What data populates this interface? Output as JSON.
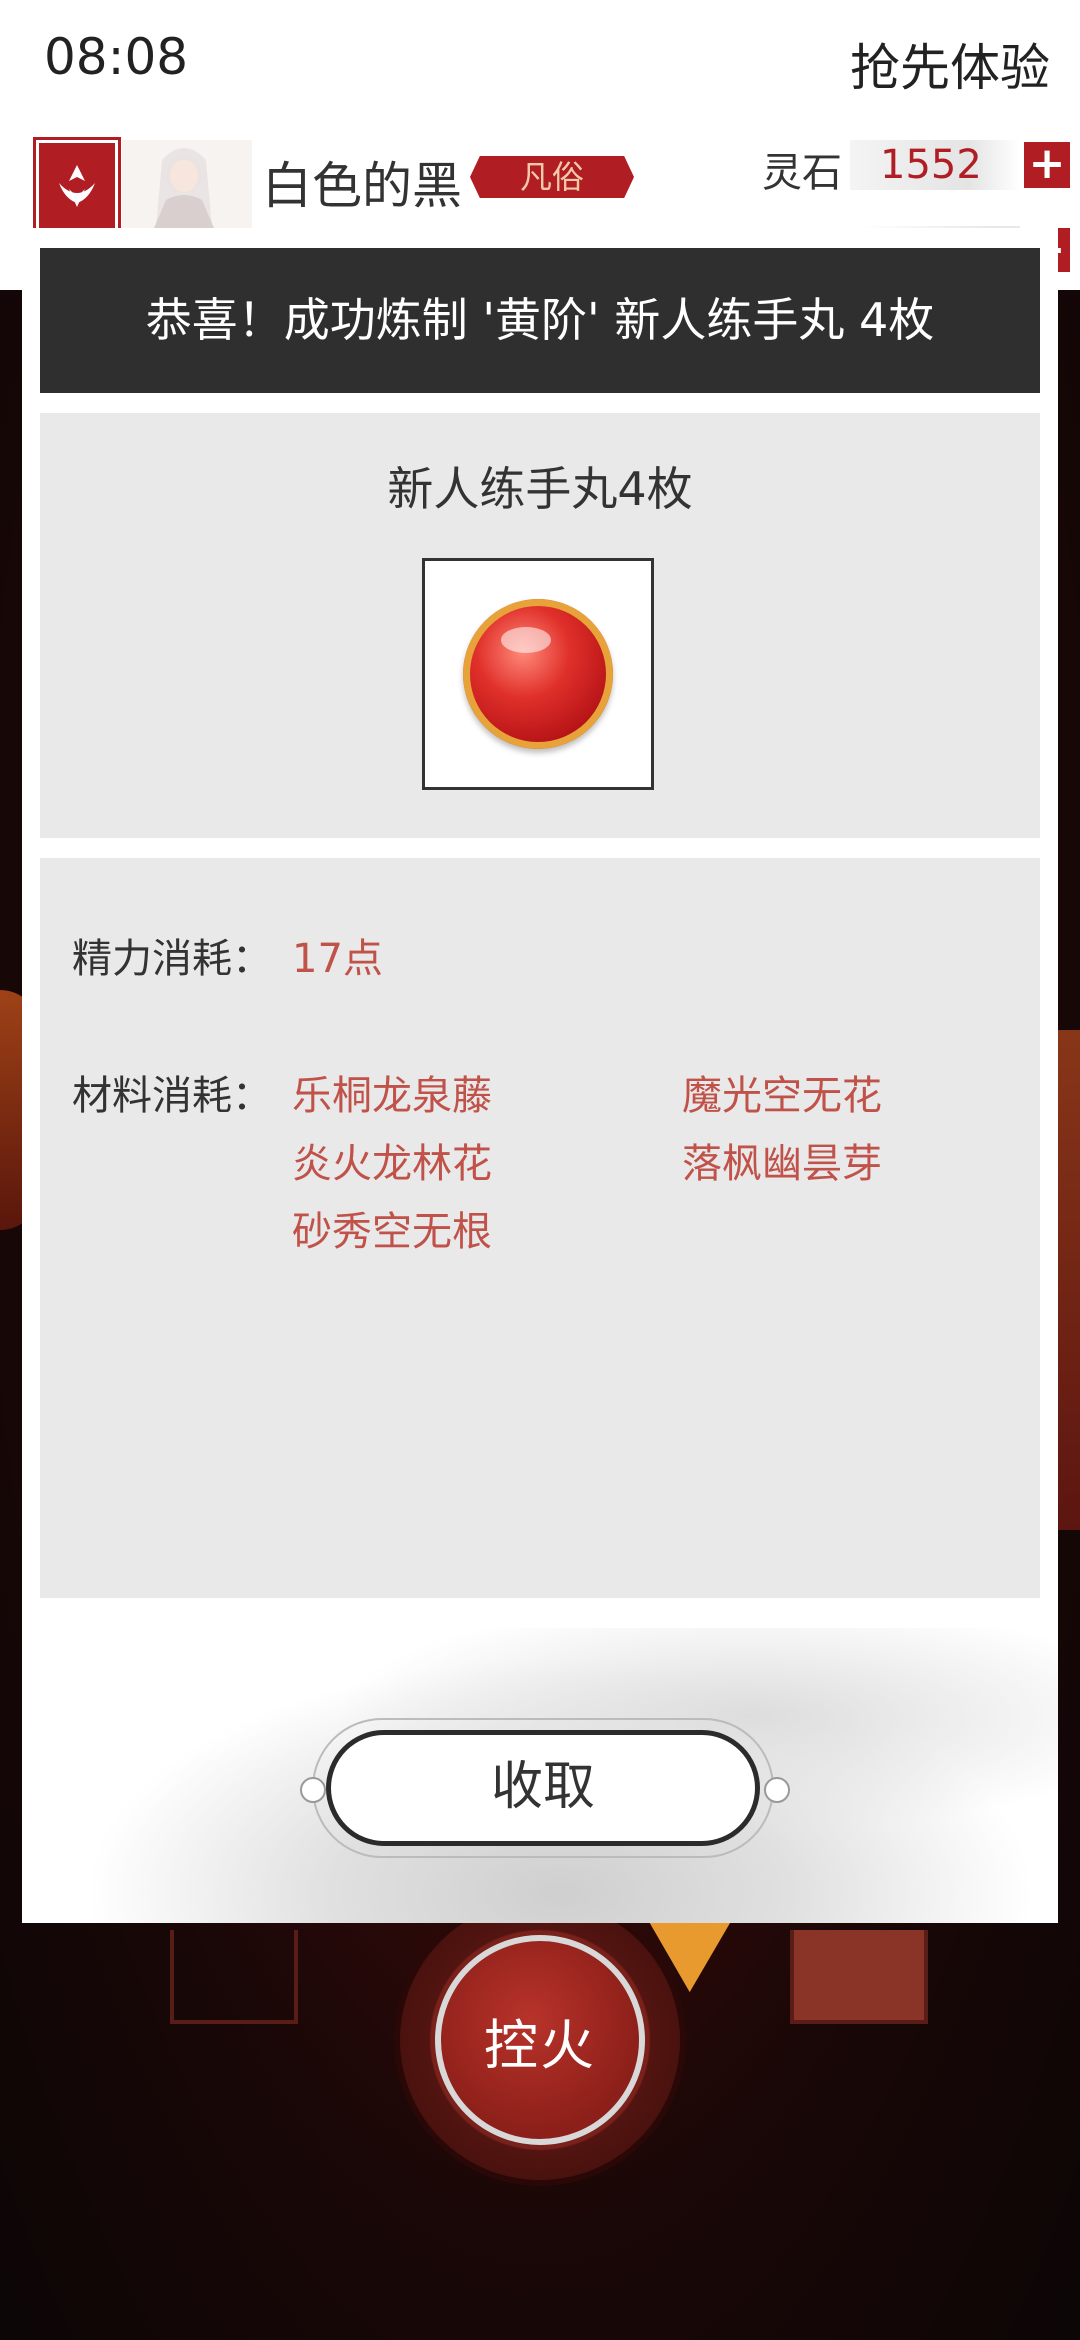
{
  "status": {
    "time": "08:08",
    "early_access": "抢先体验"
  },
  "header": {
    "username": "白色的黑",
    "rank": "凡俗",
    "stone_label": "灵石",
    "stone_value": "1552",
    "plus": "+"
  },
  "modal": {
    "banner": "恭喜！成功炼制 '黄阶' 新人练手丸 4枚",
    "item_name": "新人练手丸4枚",
    "item_icon": "red-pill-icon",
    "energy_label": "精力消耗：",
    "energy_value": "17点",
    "materials_label": "材料消耗：",
    "materials": [
      "乐桐龙泉藤",
      "魔光空无花",
      "炎火龙林花",
      "落枫幽昙芽",
      "砂秀空无根"
    ],
    "collect_button": "收取"
  },
  "game": {
    "fire_button": "控火"
  },
  "colors": {
    "accent_red": "#b01d22",
    "value_red": "#c0524a",
    "banner_bg": "#2f2f2f",
    "panel_bg": "#e9e9e9"
  }
}
